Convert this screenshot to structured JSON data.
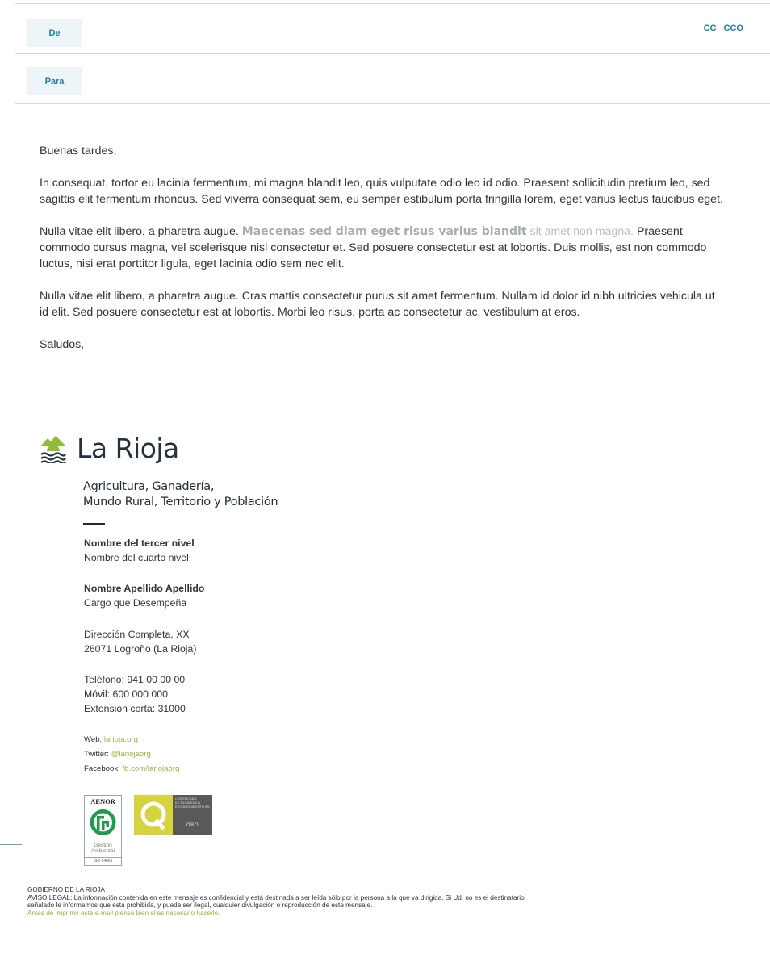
{
  "header": {
    "from_label": "De",
    "to_label": "Para",
    "cc_label": "CC",
    "bcc_label": "CCO"
  },
  "body": {
    "greeting": "Buenas tardes,",
    "p1": "In consequat, tortor eu lacinia fermentum, mi magna blandit leo, quis vulputate odio leo id odio. Praesent sollicitudin pretium leo, sed sagittis elit fermentum rhoncus. Sed viverra consequat sem, eu semper estibulum porta fringilla lorem, eget varius lectus faucibus eget.",
    "p2_start": "Nulla vitae elit libero, a pharetra augue. ",
    "p2_highlight": "Maecenas sed diam eget risus varius blandit",
    "p2_muted": " sit amet non magna.",
    "p2_end": " Praesent commodo cursus magna, vel scelerisque nisl consectetur et. Sed posuere consectetur est at lobortis. Duis mollis, est non commodo luctus, nisi erat porttitor ligula, eget lacinia odio sem nec elit.",
    "p3": "Nulla vitae elit libero, a pharetra augue. Cras mattis consectetur purus sit amet fermentum. Nullam id dolor id nibh ultricies vehicula ut id elit. Sed posuere consectetur est at lobortis. Morbi leo risus, porta ac consectetur ac, vestibulum at eros.",
    "closing": "Saludos,"
  },
  "signature": {
    "logo_text": "La Rioja",
    "dept_line1": "Agricultura, Ganadería,",
    "dept_line2": "Mundo Rural, Territorio y Población",
    "level3": "Nombre del tercer nivel",
    "level4": "Nombre del cuarto nivel",
    "name": "Nombre Apellido Apellido",
    "position": "Cargo que Desempeña",
    "address1": "Dirección Completa, XX",
    "address2": "26071 Logroño (La Rioja)",
    "phone": "Teléfono: 941 00 00 00",
    "mobile": "Móvil: 600 000 000",
    "extension": "Extensión corta: 31000",
    "web_label": "Web: ",
    "web_link": "larioja.org",
    "twitter_label": "Twitter: ",
    "twitter_link": "@lariojaorg",
    "facebook_label": "Facebook: ",
    "facebook_link": "fb.com/lariojaorg"
  },
  "badges": {
    "aenor_title": "AENOR",
    "aenor_gestion": "Gestión",
    "aenor_ambiental": "Ambiental",
    "aenor_iso": "ISO 14001",
    "q_cert_line1": "CERTIFICADO",
    "q_cert_line2": "DE EXCELENCIA",
    "q_cert_line3": "RECONOCIMIENTO EN",
    "q_oro": "ORO"
  },
  "legal": {
    "org": "GOBIERNO DE LA RIOJA",
    "notice1": "AVISO LEGAL: La información contenida en este mensaje es confidencial y está destinada a ser leída sólo por la persona a la que va dirigida. Si Ud. no es el destinatario",
    "notice2": "señalado le informamos que está prohibida, y puede ser ilegal, cualquier divulgación o reproducción de este mensaje.",
    "print_notice": "Antes de imprimir este e-mail piense bien si es necesario hacerlo."
  },
  "colors": {
    "accent_blue": "#1b7fa3",
    "link_green": "#8dbb3c",
    "logo_green": "#8dbb3c",
    "brand_dark": "#23313d"
  }
}
